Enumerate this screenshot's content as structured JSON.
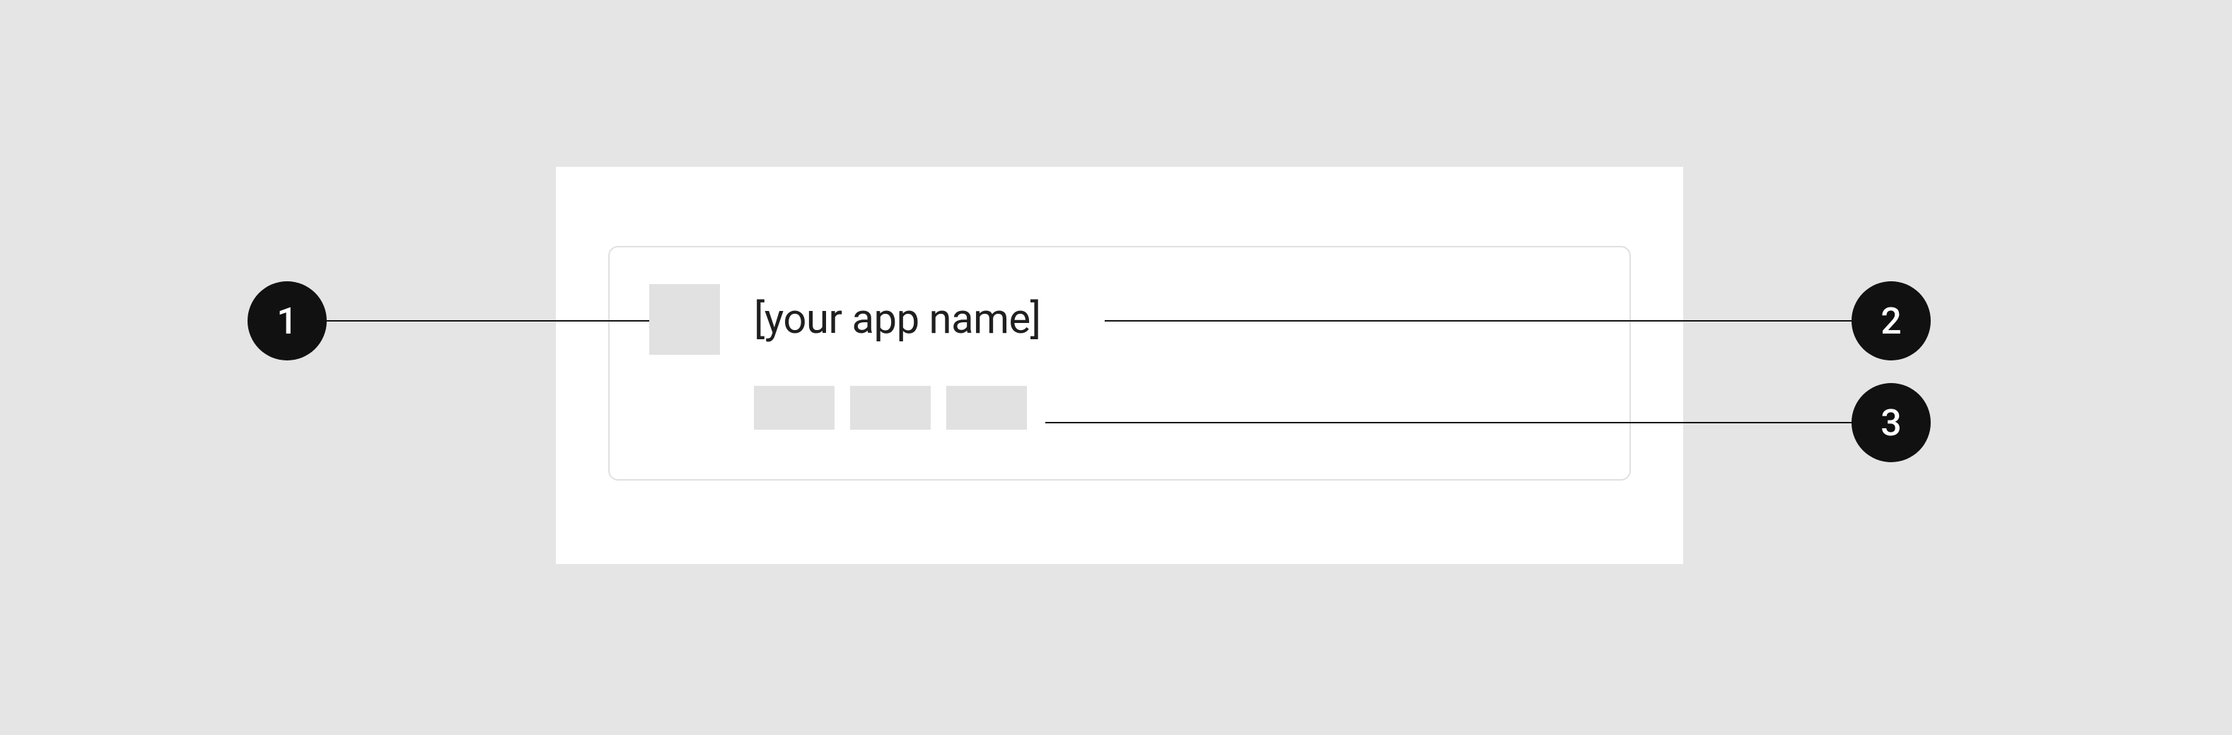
{
  "annotations": {
    "one": "1",
    "two": "2",
    "three": "3"
  },
  "card": {
    "app_name_label": "[your app name]"
  }
}
